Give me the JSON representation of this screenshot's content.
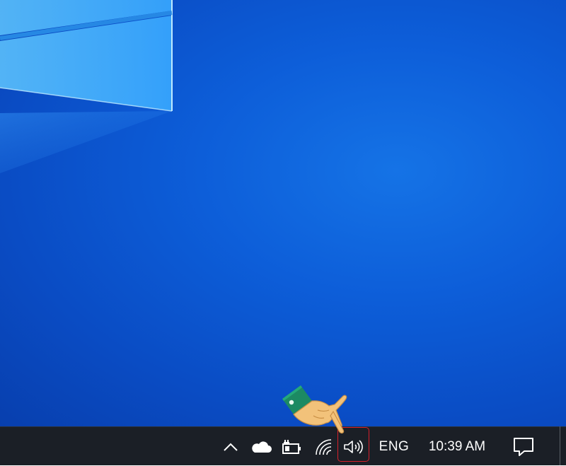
{
  "taskbar": {
    "language": "ENG",
    "clock": "10:39 AM"
  },
  "tray_icons": [
    "show-hidden-icons-chevron",
    "onedrive-cloud-icon",
    "battery-charging-icon",
    "wifi-icon",
    "volume-speaker-icon",
    "action-center-notification-icon"
  ],
  "colors": {
    "desktop_blue": "#0d5ed9",
    "taskbar": "#1b1f26",
    "highlight": "#d6202b",
    "hand_skin": "#f2c27a",
    "hand_sleeve": "#1c8a63"
  }
}
